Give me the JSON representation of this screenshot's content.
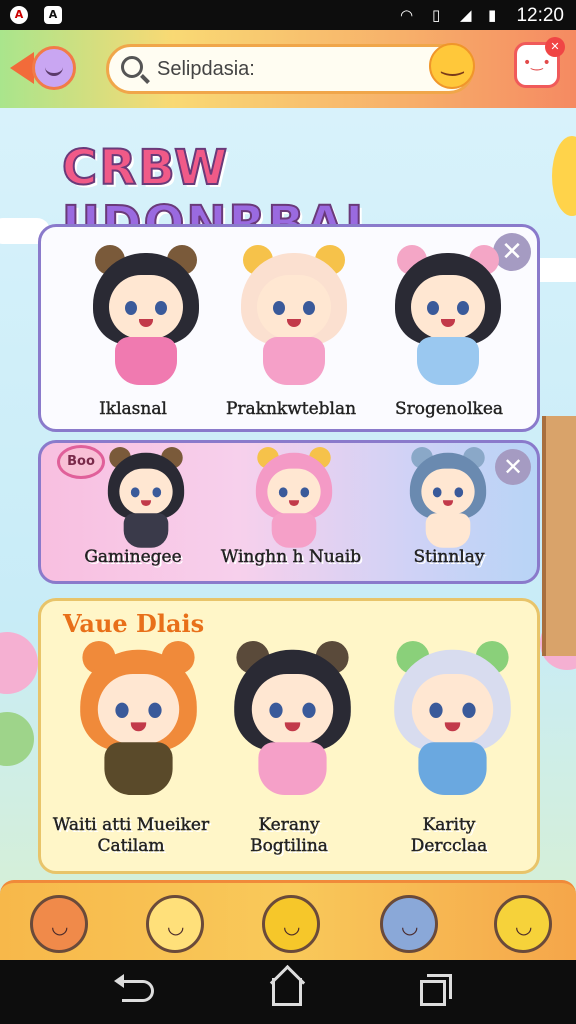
{
  "status_bar": {
    "time": "12:20"
  },
  "search": {
    "text": "Selipdasia:"
  },
  "title": {
    "parts": [
      "CRBW",
      " ",
      "IIDONRBAI"
    ]
  },
  "panels": [
    {
      "characters": [
        {
          "name": "Iklasnal",
          "hair": "#2a2a34",
          "ear": "#7a5a3a",
          "body": "#f07ab0"
        },
        {
          "name": "Praknkwteblan",
          "hair": "#fbe0d0",
          "ear": "#f6c24a",
          "body": "#f5a0c8"
        },
        {
          "name": "Srogenolkea",
          "hair": "#2a2a34",
          "ear": "#f4a6c6",
          "body": "#9ac8f0"
        }
      ]
    },
    {
      "tag": "Boo",
      "characters": [
        {
          "name": "Gaminegee",
          "hair": "#2a2a34",
          "ear": "#7a5a3a",
          "body": "#3a3a4a"
        },
        {
          "name": "Winghn h Nuaib",
          "hair": "#f49ac6",
          "ear": "#f6c24a",
          "body": "#f5a0c8"
        },
        {
          "name": "Stinnlay",
          "hair": "#6a8ab0",
          "ear": "#8aa8c8",
          "body": "#ffe7d2"
        }
      ]
    },
    {
      "section_title": "Vaue Dlais",
      "characters": [
        {
          "name": "Waiti atti Mueiker\nCatilam",
          "hair": "#f08a3a",
          "ear": "#f08a3a",
          "body": "#5a4a2a"
        },
        {
          "name": "Kerany\nBogtilina",
          "hair": "#2a2a34",
          "ear": "#5a4a3a",
          "body": "#f5a0c8"
        },
        {
          "name": "Karity\nDercclaa",
          "hair": "#d8dcef",
          "ear": "#8ad07a",
          "body": "#6aa8e0"
        }
      ]
    }
  ],
  "tray": {
    "mascots": [
      {
        "color": "#f08a4a"
      },
      {
        "color": "#ffe07a"
      },
      {
        "color": "#f6c72a"
      },
      {
        "color": "#8aa8d8"
      },
      {
        "color": "#f6d23a"
      }
    ]
  }
}
